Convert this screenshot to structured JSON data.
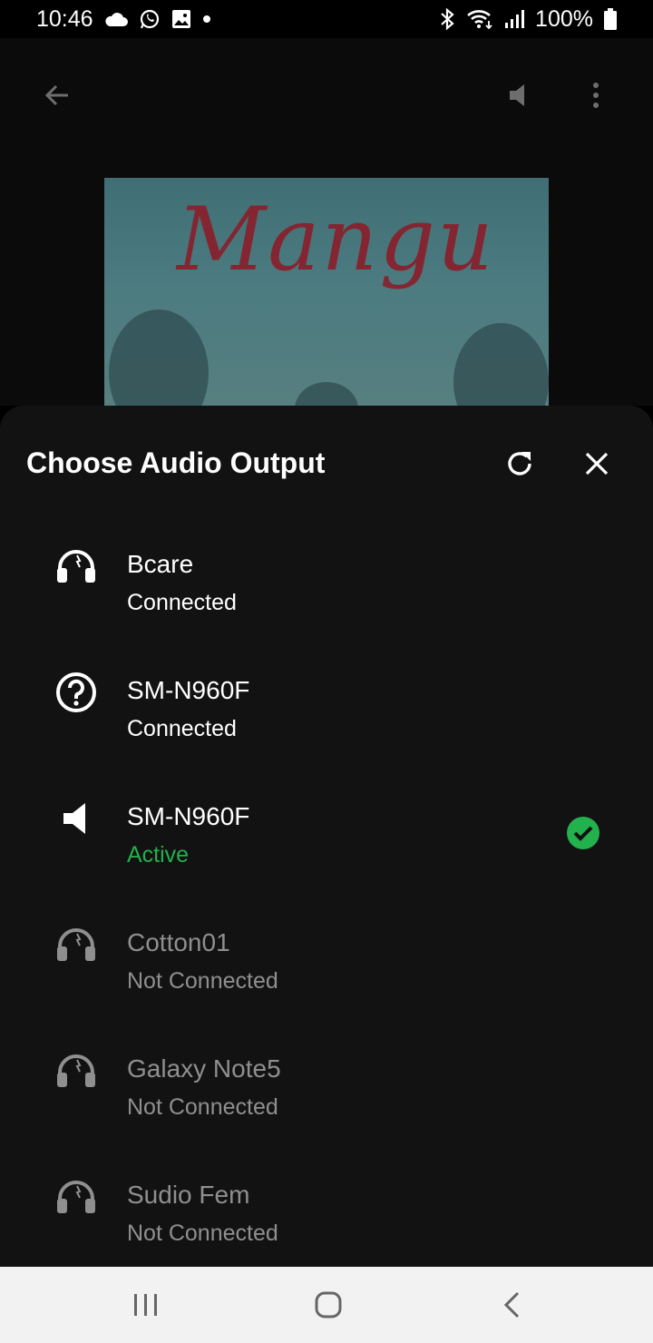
{
  "status_bar": {
    "time": "10:46",
    "battery": "100%",
    "left_icons": [
      "cloud-icon",
      "whatsapp-icon",
      "gallery-icon",
      "dot-icon"
    ],
    "right_icons": [
      "bluetooth-icon",
      "wifi-icon",
      "signal-icon",
      "battery-icon"
    ]
  },
  "player": {
    "album_title": "Mangu"
  },
  "sheet": {
    "title": "Choose Audio Output",
    "devices": [
      {
        "name": "Bcare",
        "status": "Connected",
        "icon": "headphones-icon",
        "state": "connected"
      },
      {
        "name": "SM-N960F",
        "status": "Connected",
        "icon": "help-icon",
        "state": "connected"
      },
      {
        "name": "SM-N960F",
        "status": "Active",
        "icon": "speaker-icon",
        "state": "active"
      },
      {
        "name": "Cotton01",
        "status": "Not Connected",
        "icon": "headphones-icon",
        "state": "disconnected"
      },
      {
        "name": "Galaxy Note5",
        "status": "Not Connected",
        "icon": "headphones-icon",
        "state": "disconnected"
      },
      {
        "name": "Sudio Fem",
        "status": "Not Connected",
        "icon": "headphones-icon",
        "state": "disconnected"
      }
    ]
  },
  "colors": {
    "accent_green": "#22b14c",
    "sheet_bg": "#121212",
    "dim_text": "#8f8f8f"
  }
}
